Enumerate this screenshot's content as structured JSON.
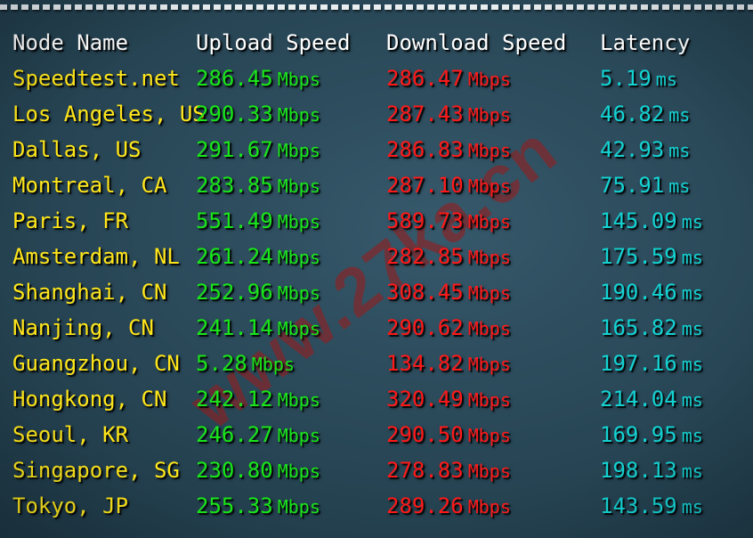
{
  "decor": {
    "dashed_rule": "dashed-separator",
    "watermark_text": "www.27ka.cn"
  },
  "colors": {
    "node": "#ffe61a",
    "upload": "#19e619",
    "download": "#ff1919",
    "latency": "#14d2d2",
    "header": "#ffffff",
    "background": "#274554",
    "watermark": "#921e20"
  },
  "table": {
    "columns": [
      {
        "key": "node",
        "label": "Node Name"
      },
      {
        "key": "upload",
        "label": "Upload Speed"
      },
      {
        "key": "download",
        "label": "Download Speed"
      },
      {
        "key": "latency",
        "label": "Latency"
      }
    ],
    "units": {
      "speed": "Mbps",
      "latency": "ms"
    },
    "rows": [
      {
        "node": "Speedtest.net",
        "upload": "286.45",
        "download": "286.47",
        "latency": "5.19",
        "upload_unit": "Mbps",
        "download_unit": "Mbps",
        "latency_unit": "ms"
      },
      {
        "node": "Los Angeles, US",
        "upload": "290.33",
        "download": "287.43",
        "latency": "46.82",
        "upload_unit": "Mbps",
        "download_unit": "Mbps",
        "latency_unit": "ms"
      },
      {
        "node": "Dallas, US",
        "upload": "291.67",
        "download": "286.83",
        "latency": "42.93",
        "upload_unit": "Mbps",
        "download_unit": "Mbps",
        "latency_unit": "ms"
      },
      {
        "node": "Montreal, CA",
        "upload": "283.85",
        "download": "287.10",
        "latency": "75.91",
        "upload_unit": "Mbps",
        "download_unit": "Mbps",
        "latency_unit": "ms"
      },
      {
        "node": "Paris, FR",
        "upload": "551.49",
        "download": "589.73",
        "latency": "145.09",
        "upload_unit": "Mbps",
        "download_unit": "Mbps",
        "latency_unit": "ms"
      },
      {
        "node": "Amsterdam, NL",
        "upload": "261.24",
        "download": "282.85",
        "latency": "175.59",
        "upload_unit": "Mbps",
        "download_unit": "Mbps",
        "latency_unit": "ms"
      },
      {
        "node": "Shanghai, CN",
        "upload": "252.96",
        "download": "308.45",
        "latency": "190.46",
        "upload_unit": "Mbps",
        "download_unit": "Mbps",
        "latency_unit": "ms"
      },
      {
        "node": "Nanjing, CN",
        "upload": "241.14",
        "download": "290.62",
        "latency": "165.82",
        "upload_unit": "Mbps",
        "download_unit": "Mbps",
        "latency_unit": "ms"
      },
      {
        "node": "Guangzhou, CN",
        "upload": "5.28",
        "download": "134.82",
        "latency": "197.16",
        "upload_unit": "Mbps",
        "download_unit": "Mbps",
        "latency_unit": "ms"
      },
      {
        "node": "Hongkong, CN",
        "upload": "242.12",
        "download": "320.49",
        "latency": "214.04",
        "upload_unit": "Mbps",
        "download_unit": "Mbps",
        "latency_unit": "ms"
      },
      {
        "node": "Seoul, KR",
        "upload": "246.27",
        "download": "290.50",
        "latency": "169.95",
        "upload_unit": "Mbps",
        "download_unit": "Mbps",
        "latency_unit": "ms"
      },
      {
        "node": "Singapore, SG",
        "upload": "230.80",
        "download": "278.83",
        "latency": "198.13",
        "upload_unit": "Mbps",
        "download_unit": "Mbps",
        "latency_unit": "ms"
      },
      {
        "node": "Tokyo, JP",
        "upload": "255.33",
        "download": "289.26",
        "latency": "143.59",
        "upload_unit": "Mbps",
        "download_unit": "Mbps",
        "latency_unit": "ms"
      }
    ]
  }
}
